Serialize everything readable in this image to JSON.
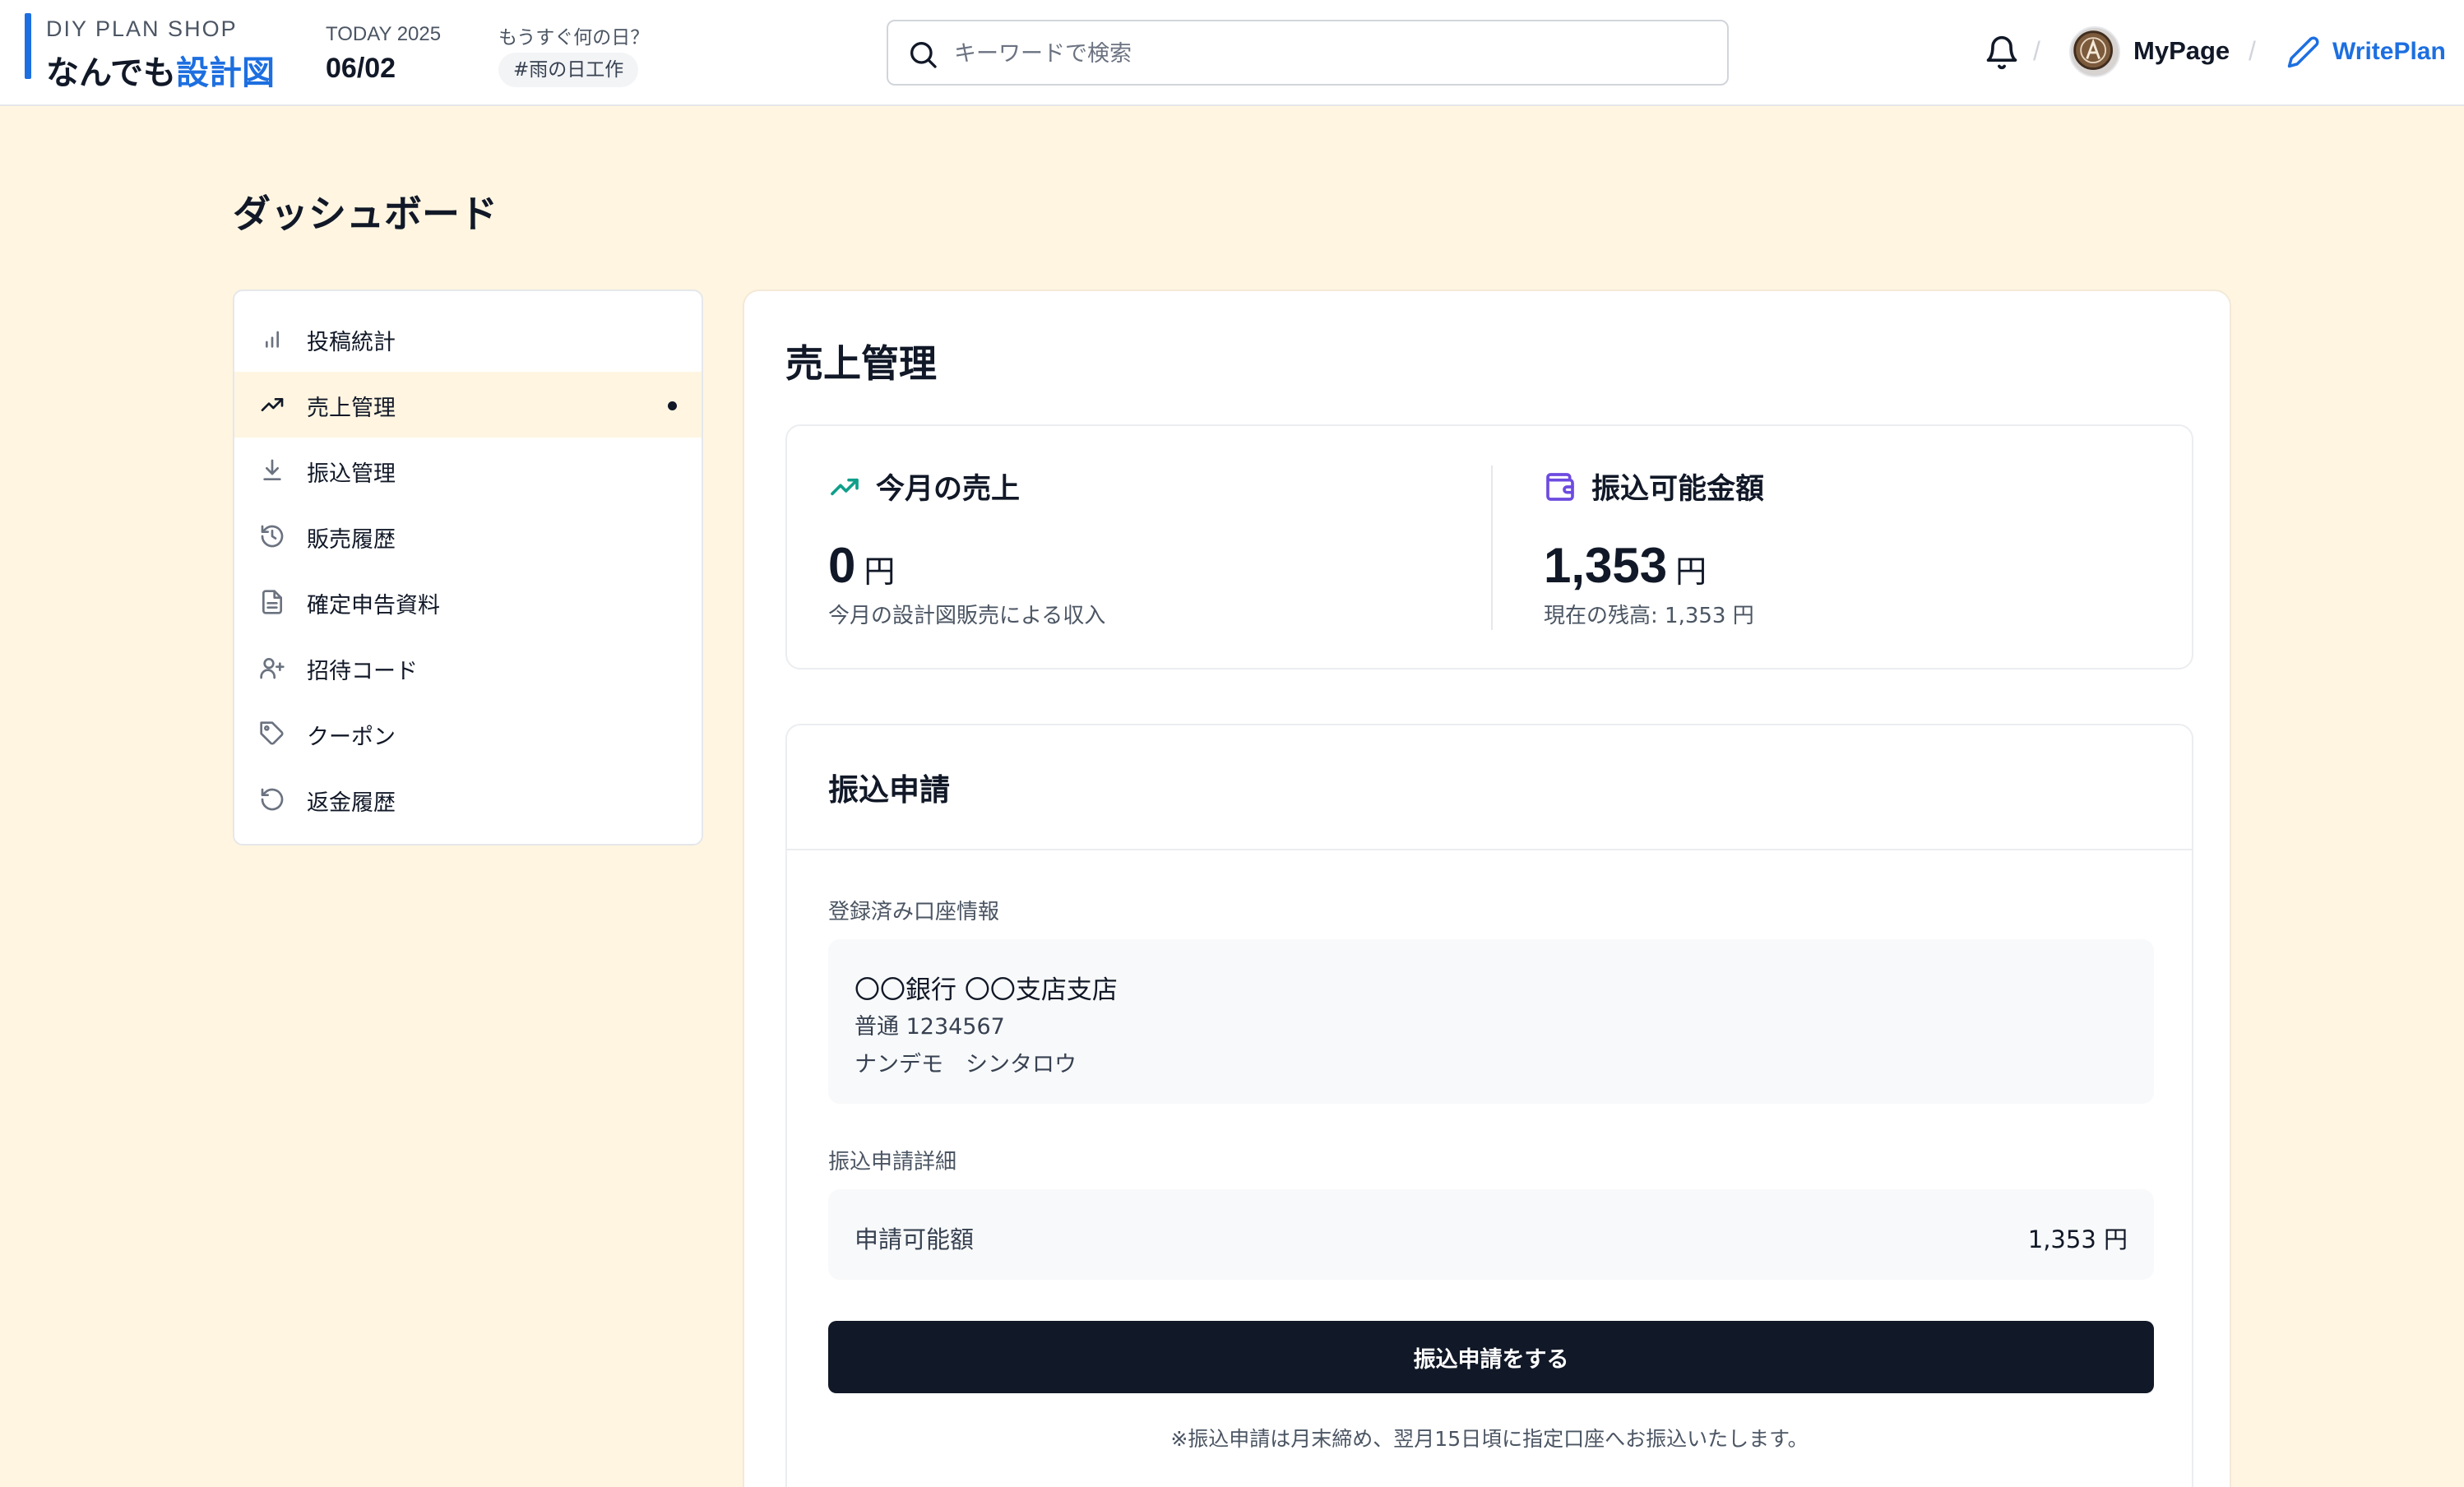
{
  "header": {
    "brand_sub": "DIY PLAN SHOP",
    "brand_main_prefix": "なんでも",
    "brand_main_accent": "設計図",
    "today_label": "TODAY 2025",
    "today_date": "06/02",
    "upcoming_label": "もうすぐ何の日？",
    "upcoming_tag": "#雨の日工作",
    "search_placeholder": "キーワードで検索",
    "separator": "/",
    "mypage_label": "MyPage",
    "writeplan_label": "WritePlan",
    "accent_color": "#1d6fe0"
  },
  "page_title": "ダッシュボード",
  "sidebar": {
    "items": [
      {
        "label": "投稿統計",
        "icon": "bar-chart-icon"
      },
      {
        "label": "売上管理",
        "icon": "trending-up-icon",
        "active": true
      },
      {
        "label": "振込管理",
        "icon": "download-icon"
      },
      {
        "label": "販売履歴",
        "icon": "history-icon"
      },
      {
        "label": "確定申告資料",
        "icon": "document-icon"
      },
      {
        "label": "招待コード",
        "icon": "user-plus-icon"
      },
      {
        "label": "クーポン",
        "icon": "tag-icon"
      },
      {
        "label": "返金履歴",
        "icon": "undo-icon"
      }
    ]
  },
  "main": {
    "title": "売上管理",
    "stats": {
      "monthly": {
        "label": "今月の売上",
        "value": "0",
        "unit": "円",
        "note": "今月の設計図販売による収入"
      },
      "transferable": {
        "label": "振込可能金額",
        "value": "1,353",
        "unit": "円",
        "note": "現在の残高: 1,353 円"
      }
    },
    "transfer": {
      "title": "振込申請",
      "account_label": "登録済み口座情報",
      "bank_name": "〇〇銀行 〇〇支店支店",
      "account": "普通 1234567",
      "holder": "ナンデモ　シンタロウ",
      "detail_label": "振込申請詳細",
      "amount_label": "申請可能額",
      "amount_value": "1,353 円",
      "button_label": "振込申請をする",
      "note": "※振込申請は月末締め、翌月15日頃に指定口座へお振込いたします。"
    }
  }
}
